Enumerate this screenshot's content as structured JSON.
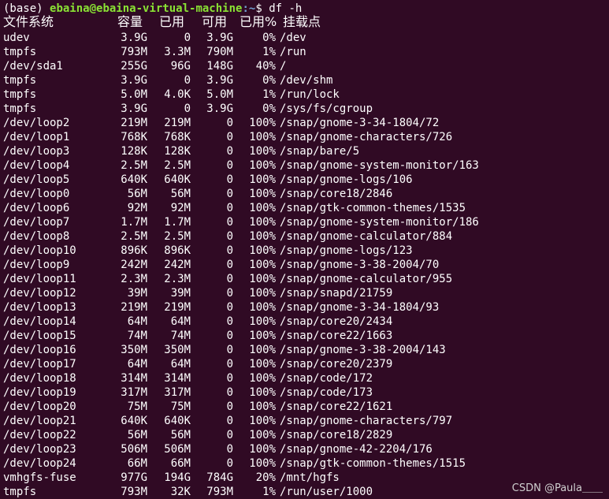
{
  "prompt": {
    "env": "(base)",
    "user_host": "ebaina@ebaina-virtual-machine",
    "path": ":~",
    "symbol": "$",
    "command": "df -h"
  },
  "table": {
    "headers": [
      "文件系统",
      "容量",
      "已用",
      "可用",
      "已用%",
      "挂载点"
    ],
    "rows": [
      [
        "udev",
        "3.9G",
        "0",
        "3.9G",
        "0%",
        "/dev"
      ],
      [
        "tmpfs",
        "793M",
        "3.3M",
        "790M",
        "1%",
        "/run"
      ],
      [
        "/dev/sda1",
        "255G",
        "96G",
        "148G",
        "40%",
        "/"
      ],
      [
        "tmpfs",
        "3.9G",
        "0",
        "3.9G",
        "0%",
        "/dev/shm"
      ],
      [
        "tmpfs",
        "5.0M",
        "4.0K",
        "5.0M",
        "1%",
        "/run/lock"
      ],
      [
        "tmpfs",
        "3.9G",
        "0",
        "3.9G",
        "0%",
        "/sys/fs/cgroup"
      ],
      [
        "/dev/loop2",
        "219M",
        "219M",
        "0",
        "100%",
        "/snap/gnome-3-34-1804/72"
      ],
      [
        "/dev/loop1",
        "768K",
        "768K",
        "0",
        "100%",
        "/snap/gnome-characters/726"
      ],
      [
        "/dev/loop3",
        "128K",
        "128K",
        "0",
        "100%",
        "/snap/bare/5"
      ],
      [
        "/dev/loop4",
        "2.5M",
        "2.5M",
        "0",
        "100%",
        "/snap/gnome-system-monitor/163"
      ],
      [
        "/dev/loop5",
        "640K",
        "640K",
        "0",
        "100%",
        "/snap/gnome-logs/106"
      ],
      [
        "/dev/loop0",
        "56M",
        "56M",
        "0",
        "100%",
        "/snap/core18/2846"
      ],
      [
        "/dev/loop6",
        "92M",
        "92M",
        "0",
        "100%",
        "/snap/gtk-common-themes/1535"
      ],
      [
        "/dev/loop7",
        "1.7M",
        "1.7M",
        "0",
        "100%",
        "/snap/gnome-system-monitor/186"
      ],
      [
        "/dev/loop8",
        "2.5M",
        "2.5M",
        "0",
        "100%",
        "/snap/gnome-calculator/884"
      ],
      [
        "/dev/loop10",
        "896K",
        "896K",
        "0",
        "100%",
        "/snap/gnome-logs/123"
      ],
      [
        "/dev/loop9",
        "242M",
        "242M",
        "0",
        "100%",
        "/snap/gnome-3-38-2004/70"
      ],
      [
        "/dev/loop11",
        "2.3M",
        "2.3M",
        "0",
        "100%",
        "/snap/gnome-calculator/955"
      ],
      [
        "/dev/loop12",
        "39M",
        "39M",
        "0",
        "100%",
        "/snap/snapd/21759"
      ],
      [
        "/dev/loop13",
        "219M",
        "219M",
        "0",
        "100%",
        "/snap/gnome-3-34-1804/93"
      ],
      [
        "/dev/loop14",
        "64M",
        "64M",
        "0",
        "100%",
        "/snap/core20/2434"
      ],
      [
        "/dev/loop15",
        "74M",
        "74M",
        "0",
        "100%",
        "/snap/core22/1663"
      ],
      [
        "/dev/loop16",
        "350M",
        "350M",
        "0",
        "100%",
        "/snap/gnome-3-38-2004/143"
      ],
      [
        "/dev/loop17",
        "64M",
        "64M",
        "0",
        "100%",
        "/snap/core20/2379"
      ],
      [
        "/dev/loop18",
        "314M",
        "314M",
        "0",
        "100%",
        "/snap/code/172"
      ],
      [
        "/dev/loop19",
        "317M",
        "317M",
        "0",
        "100%",
        "/snap/code/173"
      ],
      [
        "/dev/loop20",
        "75M",
        "75M",
        "0",
        "100%",
        "/snap/core22/1621"
      ],
      [
        "/dev/loop21",
        "640K",
        "640K",
        "0",
        "100%",
        "/snap/gnome-characters/797"
      ],
      [
        "/dev/loop22",
        "56M",
        "56M",
        "0",
        "100%",
        "/snap/core18/2829"
      ],
      [
        "/dev/loop23",
        "506M",
        "506M",
        "0",
        "100%",
        "/snap/gnome-42-2204/176"
      ],
      [
        "/dev/loop24",
        "66M",
        "66M",
        "0",
        "100%",
        "/snap/gtk-common-themes/1515"
      ],
      [
        "vmhgfs-fuse",
        "977G",
        "194G",
        "784G",
        "20%",
        "/mnt/hgfs"
      ],
      [
        "tmpfs",
        "793M",
        "32K",
        "793M",
        "1%",
        "/run/user/1000"
      ]
    ]
  },
  "watermark": "CSDN @Paula＿＿",
  "colors": {
    "background": "#300a24",
    "text": "#ffffff",
    "user_host": "#8ae234",
    "path": "#729fcf"
  }
}
